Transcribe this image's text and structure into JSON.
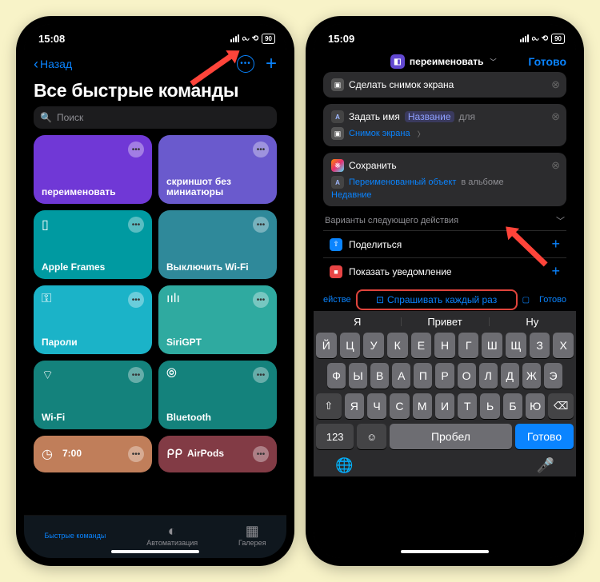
{
  "status": {
    "time_left": "15:08",
    "time_right": "15:09",
    "battery": "90"
  },
  "left": {
    "back": "Назад",
    "title": "Все быстрые команды",
    "search_placeholder": "Поиск",
    "tiles": [
      {
        "name": "переименовать",
        "color": "#7038d6",
        "icon": "layers"
      },
      {
        "name": "скриншот без миниатюры",
        "color": "#6a5acd",
        "icon": "layers"
      },
      {
        "name": "Apple Frames",
        "color": "#009aa1",
        "icon": "phone"
      },
      {
        "name": "Выключить Wi-Fi",
        "color": "#2f899a",
        "icon": "layers"
      },
      {
        "name": "Пароли",
        "color": "#1bb3c8",
        "icon": "key"
      },
      {
        "name": "SiriGPT",
        "color": "#2faaa0",
        "icon": "siri"
      },
      {
        "name": "Wi-Fi",
        "color": "#14827c",
        "icon": "wifi"
      },
      {
        "name": "Bluetooth",
        "color": "#14827c",
        "icon": "bt"
      },
      {
        "name": "7:00",
        "color": "#c07e5a",
        "icon": "clock"
      },
      {
        "name": "AirPods",
        "color": "#823b45",
        "icon": "airpods"
      }
    ],
    "tabs": {
      "shortcuts": "Быстрые команды",
      "automation": "Автоматизация",
      "gallery": "Галерея"
    }
  },
  "right": {
    "title": "переименовать",
    "done": "Готово",
    "act1": "Сделать снимок экрана",
    "act2_pre": "Задать имя",
    "act2_field": "Название",
    "act2_post": "для",
    "act2_sub": "Снимок экрана",
    "act3": "Сохранить",
    "act3_sub1": "Переименованный объект",
    "act3_sub2": "в альбоме",
    "act3_sub3": "Недавние",
    "next_label": "Варианты следующего действия",
    "next1": "Поделиться",
    "next2": "Показать уведомление",
    "sb_left": "ействе",
    "sb_mid": "Спрашивать каждый раз",
    "sb_right": "Готово",
    "suggestions": [
      "Я",
      "Привет",
      "Ну"
    ],
    "keys": {
      "row1": [
        "Й",
        "Ц",
        "У",
        "К",
        "Е",
        "Н",
        "Г",
        "Ш",
        "Щ",
        "З",
        "Х"
      ],
      "row2": [
        "Ф",
        "Ы",
        "В",
        "А",
        "П",
        "Р",
        "О",
        "Л",
        "Д",
        "Ж",
        "Э"
      ],
      "row3": [
        "Я",
        "Ч",
        "С",
        "М",
        "И",
        "Т",
        "Ь",
        "Б",
        "Ю"
      ],
      "n123": "123",
      "space": "Пробел",
      "go": "Готово"
    }
  }
}
